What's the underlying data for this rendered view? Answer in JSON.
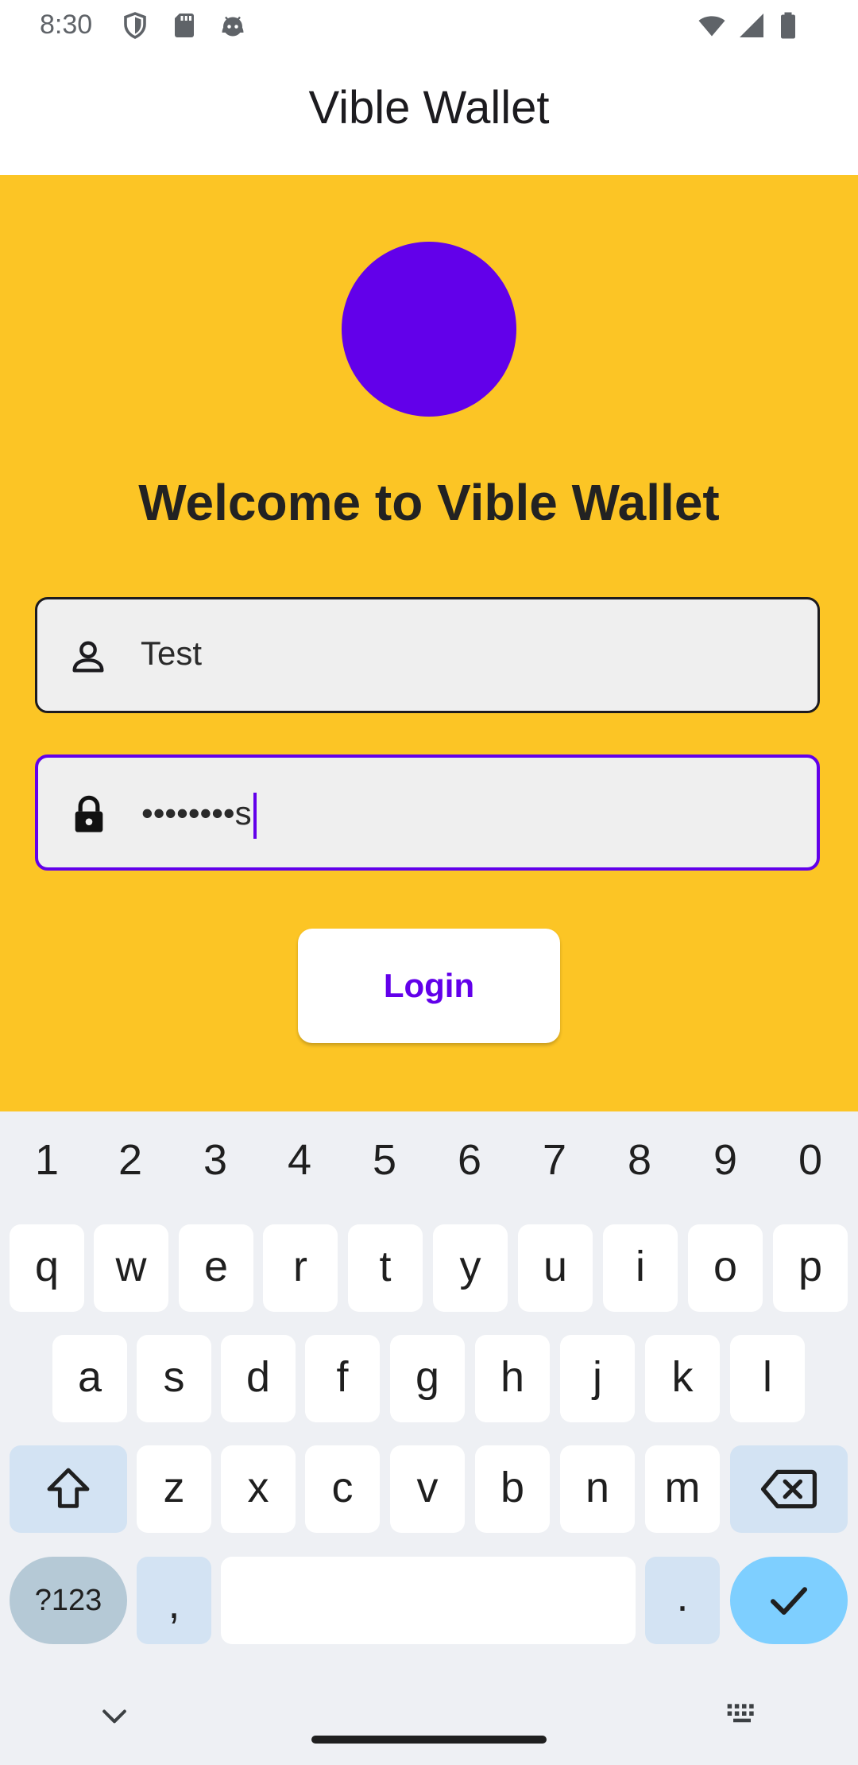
{
  "status_bar": {
    "time": "8:30",
    "left_icons": [
      "shield-icon",
      "sd-card-icon",
      "android-head-icon"
    ],
    "right_icons": [
      "wifi-icon",
      "signal-icon",
      "battery-icon"
    ]
  },
  "app_bar": {
    "title": "Vible Wallet"
  },
  "login": {
    "welcome": "Welcome to Vible Wallet",
    "username_value": "Test",
    "username_icon": "person-icon",
    "password_value": "••••••••s",
    "password_icon": "lock-icon",
    "login_label": "Login"
  },
  "colors": {
    "background": "#fcc525",
    "accent": "#6200ea",
    "field_bg": "#efefef"
  },
  "keyboard": {
    "numbers": [
      "1",
      "2",
      "3",
      "4",
      "5",
      "6",
      "7",
      "8",
      "9",
      "0"
    ],
    "row1": [
      "q",
      "w",
      "e",
      "r",
      "t",
      "y",
      "u",
      "i",
      "o",
      "p"
    ],
    "row2": [
      "a",
      "s",
      "d",
      "f",
      "g",
      "h",
      "j",
      "k",
      "l"
    ],
    "row3": [
      "z",
      "x",
      "c",
      "v",
      "b",
      "n",
      "m"
    ],
    "symbols_label": "?123",
    "comma": ",",
    "period": "."
  }
}
